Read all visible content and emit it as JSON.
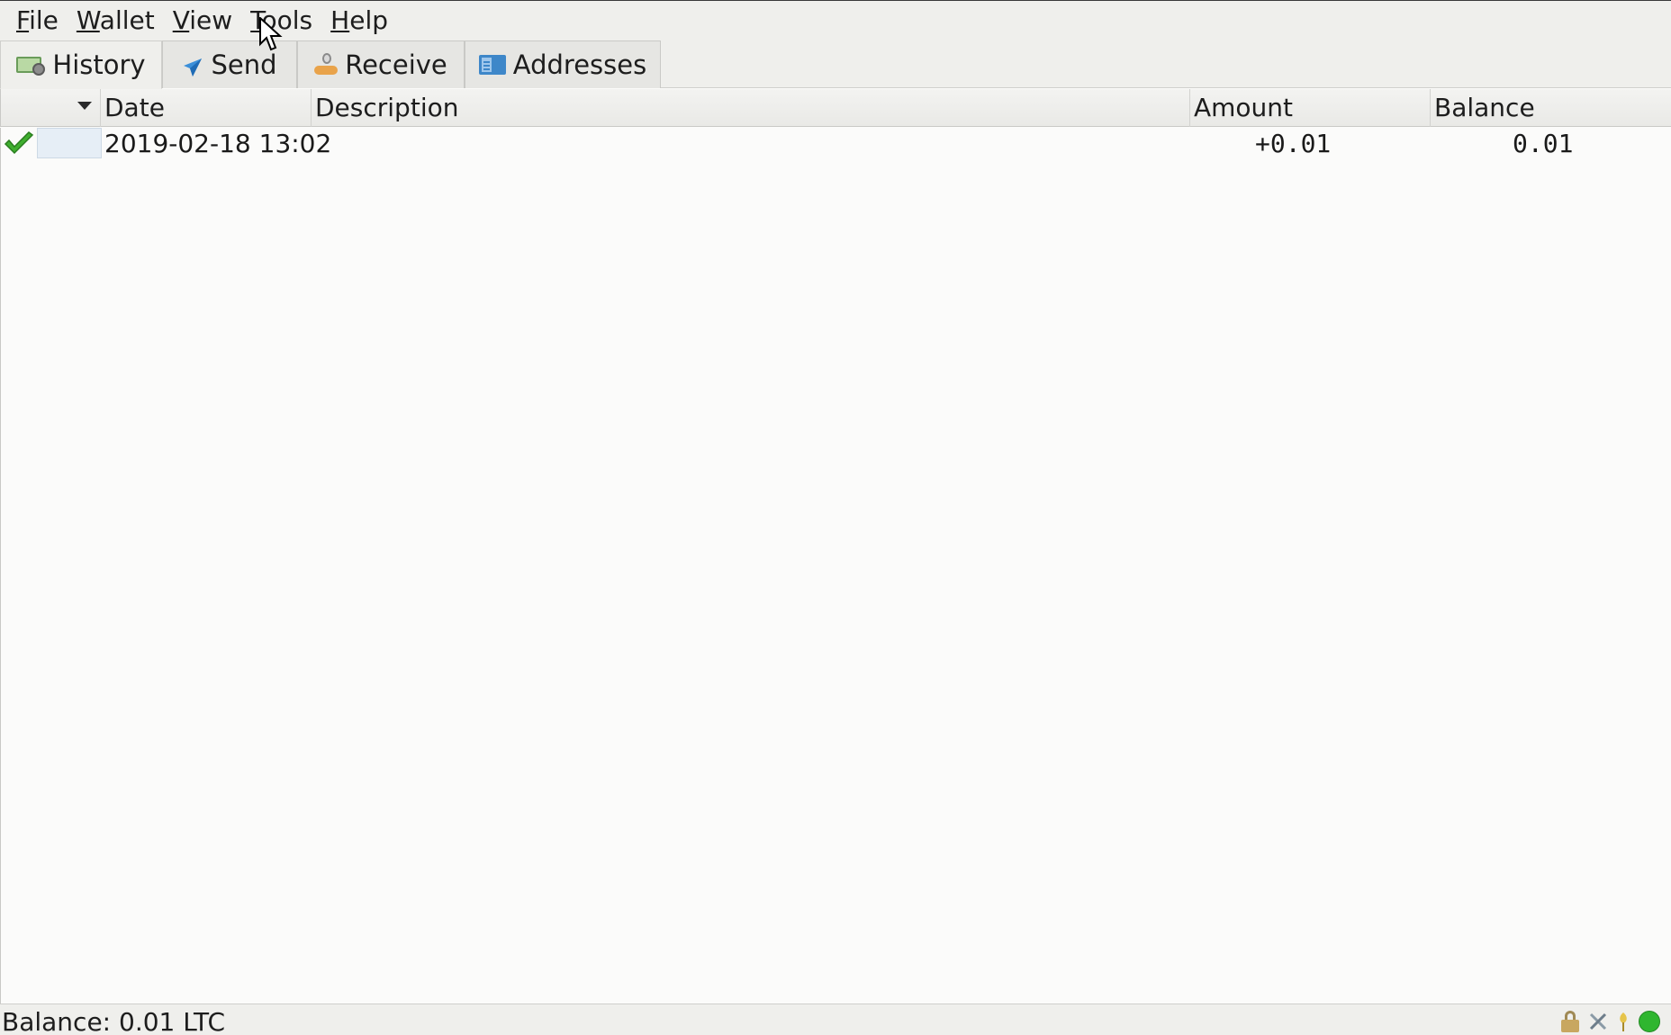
{
  "menubar": {
    "items": [
      {
        "label_first": "F",
        "label_rest": "ile"
      },
      {
        "label_first": "W",
        "label_rest": "allet"
      },
      {
        "label_first": "V",
        "label_rest": "iew"
      },
      {
        "label_first": "T",
        "label_rest": "ools"
      },
      {
        "label_first": "H",
        "label_rest": "elp"
      }
    ]
  },
  "tabs": [
    {
      "label": "History",
      "icon": "history-icon",
      "active": true
    },
    {
      "label": "Send",
      "icon": "send-icon",
      "active": false
    },
    {
      "label": "Receive",
      "icon": "receive-icon",
      "active": false
    },
    {
      "label": "Addresses",
      "icon": "addresses-icon",
      "active": false
    }
  ],
  "table": {
    "columns": [
      "Date",
      "Description",
      "Amount",
      "Balance"
    ],
    "sort": "descending",
    "rows": [
      {
        "status_icon": "confirmed-check-icon",
        "date": "2019-02-18 13:02",
        "description": "",
        "amount": "+0.01",
        "balance": "0.01"
      }
    ]
  },
  "statusbar": {
    "balance": "Balance: 0.01 LTC",
    "icons": [
      "lock-icon",
      "tools-icon",
      "seed-icon",
      "network-status-icon"
    ],
    "network_status_color": "#2fb62f"
  }
}
